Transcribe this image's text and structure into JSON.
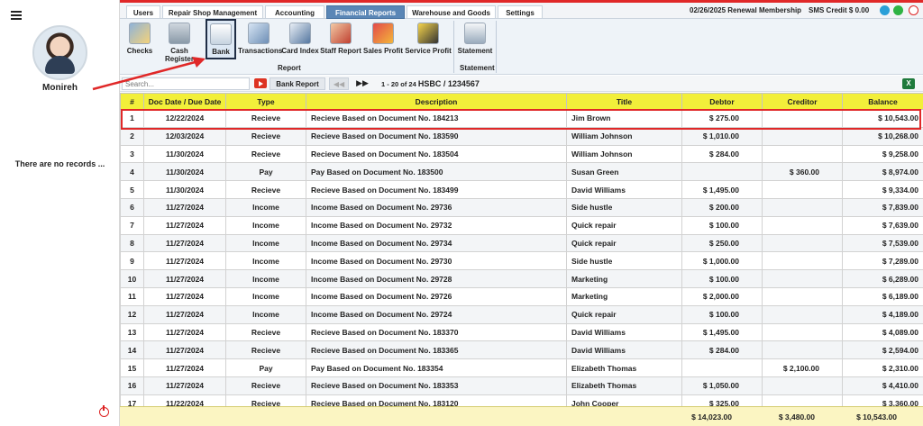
{
  "user": {
    "name": "Monireh"
  },
  "left_panel": {
    "empty_text": "There are no records ..."
  },
  "top_tabs": [
    {
      "label": "Users",
      "active": false
    },
    {
      "label": "Repair Shop Management",
      "active": false
    },
    {
      "label": "Accounting",
      "active": false
    },
    {
      "label": "Financial Reports",
      "active": true
    },
    {
      "label": "Warehouse and Goods",
      "active": false
    },
    {
      "label": "Settings",
      "active": false
    }
  ],
  "top_status": {
    "membership": "02/26/2025 Renewal Membership",
    "sms_credit": "SMS Credit $ 0.00"
  },
  "ribbon": {
    "buttons": [
      {
        "label": "Checks",
        "icon": "checks-icon"
      },
      {
        "label": "Cash Register",
        "icon": "cash-register-icon"
      },
      {
        "label": "Bank",
        "icon": "bank-icon",
        "selected": true
      },
      {
        "label": "Transactions",
        "icon": "transactions-icon"
      },
      {
        "label": "Card Index",
        "icon": "card-index-icon"
      },
      {
        "label": "Staff Report",
        "icon": "staff-report-icon"
      },
      {
        "label": "Sales Profit",
        "icon": "sales-profit-icon"
      },
      {
        "label": "Service Profit",
        "icon": "service-profit-icon"
      },
      {
        "label": "Statement",
        "icon": "statement-icon"
      }
    ],
    "group_report": "Report",
    "group_statement": "Statement"
  },
  "toolbar": {
    "search_placeholder": "Search...",
    "bank_report_label": "Bank Report",
    "paging": "1 - 20 of 24",
    "account": "HSBC / 1234567"
  },
  "table": {
    "headers": [
      "#",
      "Doc Date / Due Date",
      "Type",
      "Description",
      "Title",
      "Debtor",
      "Creditor",
      "Balance"
    ],
    "rows": [
      [
        "1",
        "12/22/2024",
        "Recieve",
        "Recieve Based on Document No. 184213",
        "Jim Brown",
        "$ 275.00",
        "",
        "$ 10,543.00"
      ],
      [
        "2",
        "12/03/2024",
        "Recieve",
        "Recieve Based on Document No. 183590",
        "William Johnson",
        "$ 1,010.00",
        "",
        "$ 10,268.00"
      ],
      [
        "3",
        "11/30/2024",
        "Recieve",
        "Recieve Based on Document No. 183504",
        "William Johnson",
        "$ 284.00",
        "",
        "$ 9,258.00"
      ],
      [
        "4",
        "11/30/2024",
        "Pay",
        "Pay Based on Document No. 183500",
        "Susan Green",
        "",
        "$ 360.00",
        "$ 8,974.00"
      ],
      [
        "5",
        "11/30/2024",
        "Recieve",
        "Recieve Based on Document No. 183499",
        "David Williams",
        "$ 1,495.00",
        "",
        "$ 9,334.00"
      ],
      [
        "6",
        "11/27/2024",
        "Income",
        "Income Based on Document No. 29736",
        "Side hustle",
        "$ 200.00",
        "",
        "$ 7,839.00"
      ],
      [
        "7",
        "11/27/2024",
        "Income",
        "Income Based on Document No. 29732",
        "Quick repair",
        "$ 100.00",
        "",
        "$ 7,639.00"
      ],
      [
        "8",
        "11/27/2024",
        "Income",
        "Income Based on Document No. 29734",
        "Quick repair",
        "$ 250.00",
        "",
        "$ 7,539.00"
      ],
      [
        "9",
        "11/27/2024",
        "Income",
        "Income Based on Document No. 29730",
        "Side hustle",
        "$ 1,000.00",
        "",
        "$ 7,289.00"
      ],
      [
        "10",
        "11/27/2024",
        "Income",
        "Income Based on Document No. 29728",
        "Marketing",
        "$ 100.00",
        "",
        "$ 6,289.00"
      ],
      [
        "11",
        "11/27/2024",
        "Income",
        "Income Based on Document No. 29726",
        "Marketing",
        "$ 2,000.00",
        "",
        "$ 6,189.00"
      ],
      [
        "12",
        "11/27/2024",
        "Income",
        "Income Based on Document No. 29724",
        "Quick repair",
        "$ 100.00",
        "",
        "$ 4,189.00"
      ],
      [
        "13",
        "11/27/2024",
        "Recieve",
        "Recieve Based on Document No. 183370",
        "David Williams",
        "$ 1,495.00",
        "",
        "$ 4,089.00"
      ],
      [
        "14",
        "11/27/2024",
        "Recieve",
        "Recieve Based on Document No. 183365",
        "David Williams",
        "$ 284.00",
        "",
        "$ 2,594.00"
      ],
      [
        "15",
        "11/27/2024",
        "Pay",
        "Pay Based on Document No. 183354",
        "Elizabeth Thomas",
        "",
        "$ 2,100.00",
        "$ 2,310.00"
      ],
      [
        "16",
        "11/27/2024",
        "Recieve",
        "Recieve Based on Document No. 183353",
        "Elizabeth Thomas",
        "$ 1,050.00",
        "",
        "$ 4,410.00"
      ],
      [
        "17",
        "11/22/2024",
        "Recieve",
        "Recieve Based on Document No. 183120",
        "John Cooper",
        "$ 325.00",
        "",
        "$ 3,360.00"
      ]
    ]
  },
  "totals": {
    "debtor": "$ 14,023.00",
    "creditor": "$ 3,480.00",
    "balance": "$ 10,543.00"
  },
  "colors": {
    "accent": "#5a86b6",
    "header_yellow": "#f2ef3a",
    "highlight_red": "#e02828"
  }
}
